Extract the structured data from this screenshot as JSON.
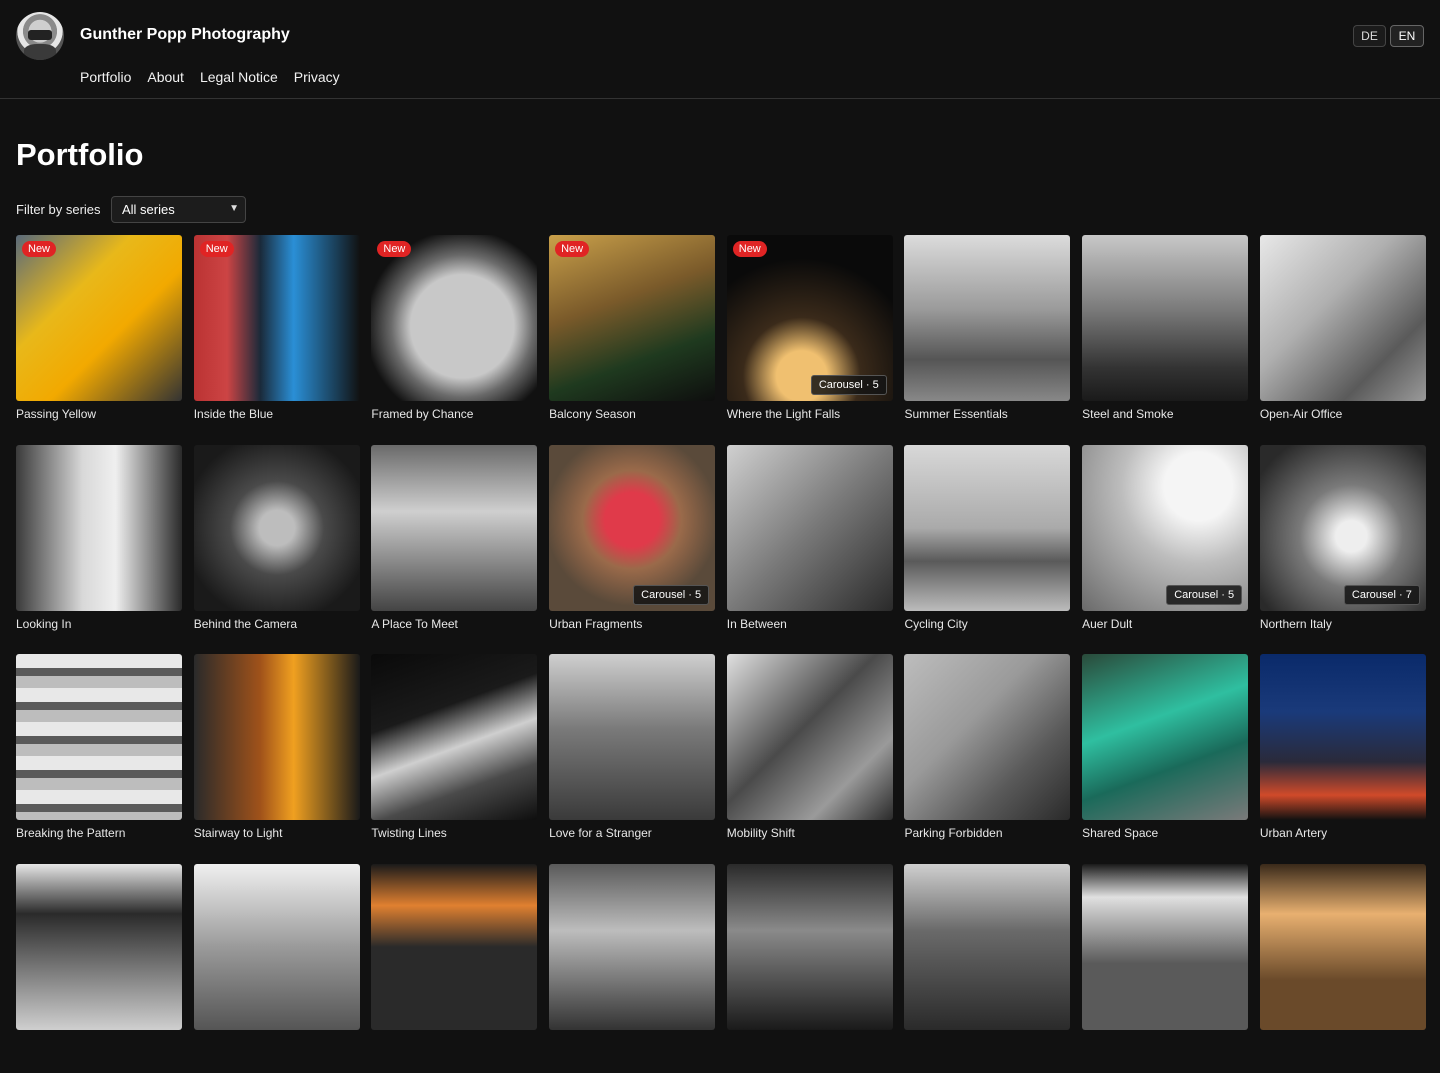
{
  "site": {
    "title": "Gunther Popp Photography"
  },
  "nav": [
    "Portfolio",
    "About",
    "Legal Notice",
    "Privacy"
  ],
  "lang": {
    "de": "DE",
    "en": "EN",
    "active": "EN"
  },
  "page": {
    "title": "Portfolio"
  },
  "filter": {
    "label": "Filter by series",
    "selected": "All series"
  },
  "badges": {
    "new": "New"
  },
  "cards": [
    {
      "title": "Passing Yellow",
      "new": true,
      "carousel": "",
      "bg": "linear-gradient(135deg,#5a6a7a 0%,#e8b81a 35%,#f2a900 60%,#333 100%)"
    },
    {
      "title": "Inside the Blue",
      "new": true,
      "carousel": "",
      "bg": "linear-gradient(90deg,#b33 0%,#c44 20%,#1a2a3a 40%,#2a8fd6 60%,#111 100%)"
    },
    {
      "title": "Framed by Chance",
      "new": true,
      "carousel": "",
      "bg": "radial-gradient(circle at 55% 55%,#c8c8c8 0 40%,#6a6a6a 55%,#111 75%)"
    },
    {
      "title": "Balcony Season",
      "new": true,
      "carousel": "",
      "bg": "linear-gradient(160deg,#c9a04a 0%,#7a5a2a 40%,#1f3a1f 70%,#0e0e0e 100%)"
    },
    {
      "title": "Where the Light Falls",
      "new": true,
      "carousel": "Carousel · 5",
      "bg": "radial-gradient(circle at 45% 85%,#f0c070 0 15%,#3a2a1a 35%,#0a0a0a 70%)"
    },
    {
      "title": "Summer Essentials",
      "new": false,
      "carousel": "",
      "bg": "linear-gradient(180deg,#dcdcdc 0%,#9a9a9a 45%,#555 75%,#888 100%)"
    },
    {
      "title": "Steel and Smoke",
      "new": false,
      "carousel": "",
      "bg": "linear-gradient(180deg,#c8c8c8 0%,#7a7a7a 45%,#333 80%,#1a1a1a 100%)"
    },
    {
      "title": "Open-Air Office",
      "new": false,
      "carousel": "",
      "bg": "linear-gradient(135deg,#e8e8e8 0%,#b0b0b0 40%,#5a5a5a 75%,#9a9a9a 100%)"
    },
    {
      "title": "Looking In",
      "new": false,
      "carousel": "",
      "bg": "linear-gradient(90deg,#3a3a3a 0%,#d8d8d8 40%,#efefef 60%,#2a2a2a 100%)"
    },
    {
      "title": "Behind the Camera",
      "new": false,
      "carousel": "",
      "bg": "radial-gradient(circle at 50% 50%,#bdbdbd 0 15%,#4a4a4a 40%,#1a1a1a 80%)"
    },
    {
      "title": "A Place To Meet",
      "new": false,
      "carousel": "",
      "bg": "linear-gradient(180deg,#6a6a6a 0%,#cfcfcf 40%,#8a8a8a 70%,#444 100%)"
    },
    {
      "title": "Urban Fragments",
      "new": false,
      "carousel": "Carousel · 5",
      "bg": "radial-gradient(circle at 50% 45%,#e03a4a 0 22%,#9a6a4a 40%,#5a4a3a 70%)"
    },
    {
      "title": "In Between",
      "new": false,
      "carousel": "",
      "bg": "linear-gradient(135deg,#d0d0d0 0%,#7a7a7a 50%,#2a2a2a 100%)"
    },
    {
      "title": "Cycling City",
      "new": false,
      "carousel": "",
      "bg": "linear-gradient(180deg,#d8d8d8 0%,#aaaaaa 50%,#5a5a5a 70%,#bcbcbc 100%)"
    },
    {
      "title": "Auer Dult",
      "new": false,
      "carousel": "Carousel · 5",
      "bg": "radial-gradient(circle at 70% 25%,#f5f5f5 0 20%,#bdbdbd 45%,#6a6a6a 100%)"
    },
    {
      "title": "Northern Italy",
      "new": false,
      "carousel": "Carousel · 7",
      "bg": "radial-gradient(circle at 55% 55%,#eeeeee 0 12%,#7a7a7a 40%,#2a2a2a 85%)"
    },
    {
      "title": "Breaking the Pattern",
      "new": false,
      "carousel": "",
      "bg": "repeating-linear-gradient(180deg,#e8e8e8 0 14px,#5a5a5a 14px 22px,#bdbdbd 22px 34px)"
    },
    {
      "title": "Stairway to Light",
      "new": false,
      "carousel": "",
      "bg": "linear-gradient(90deg,#2a2a2a 0%,#a0521a 40%,#f0a020 60%,#1a1a1a 100%)"
    },
    {
      "title": "Twisting Lines",
      "new": false,
      "carousel": "",
      "bg": "linear-gradient(160deg,#0a0a0a 0%,#1a1a1a 35%,#cfcfcf 55%,#4a4a4a 75%,#0e0e0e 100%)"
    },
    {
      "title": "Love for a Stranger",
      "new": false,
      "carousel": "",
      "bg": "linear-gradient(180deg,#cfcfcf 0%,#7a7a7a 45%,#3a3a3a 100%)"
    },
    {
      "title": "Mobility Shift",
      "new": false,
      "carousel": "",
      "bg": "linear-gradient(135deg,#e0e0e0 0%,#4a4a4a 45%,#9a9a9a 75%,#2a2a2a 100%)"
    },
    {
      "title": "Parking Forbidden",
      "new": false,
      "carousel": "",
      "bg": "linear-gradient(135deg,#bdbdbd 0%,#9a9a9a 40%,#5a5a5a 70%,#2a2a2a 100%)"
    },
    {
      "title": "Shared Space",
      "new": false,
      "carousel": "",
      "bg": "linear-gradient(160deg,#2a4a3a 0%,#2fbfa0 40%,#1a6a5a 65%,#7a7a7a 100%)"
    },
    {
      "title": "Urban Artery",
      "new": false,
      "carousel": "",
      "bg": "linear-gradient(180deg,#0a2a6a 0%,#1a3a7a 35%,#2a2a3a 65%,#d04a2a 85%,#111 100%)"
    },
    {
      "title": "",
      "new": false,
      "carousel": "",
      "bg": "linear-gradient(180deg,#e6e6e6 0%,#2a2a2a 30%,#cfcfcf 100%)"
    },
    {
      "title": "",
      "new": false,
      "carousel": "",
      "bg": "linear-gradient(180deg,#f0f0f0 0%,#9a9a9a 50%,#555 100%)"
    },
    {
      "title": "",
      "new": false,
      "carousel": "",
      "bg": "linear-gradient(180deg,#1a1a1a 0%,#e08030 25%,#2a2a2a 50%)"
    },
    {
      "title": "",
      "new": false,
      "carousel": "",
      "bg": "linear-gradient(180deg,#5a5a5a 0%,#bdbdbd 40%,#333 100%)"
    },
    {
      "title": "",
      "new": false,
      "carousel": "",
      "bg": "linear-gradient(180deg,#2a2a2a 0%,#8a8a8a 40%,#1a1a1a 100%)"
    },
    {
      "title": "",
      "new": false,
      "carousel": "",
      "bg": "linear-gradient(180deg,#cfcfcf 0%,#6a6a6a 40%,#2a2a2a 100%)"
    },
    {
      "title": "",
      "new": false,
      "carousel": "",
      "bg": "linear-gradient(180deg,#1a1a1a 0%,#e0e0e0 20%,#5a5a5a 60%)"
    },
    {
      "title": "",
      "new": false,
      "carousel": "",
      "bg": "linear-gradient(180deg,#3a2a1a 0%,#e8b070 30%,#6a4a2a 70%)"
    }
  ]
}
